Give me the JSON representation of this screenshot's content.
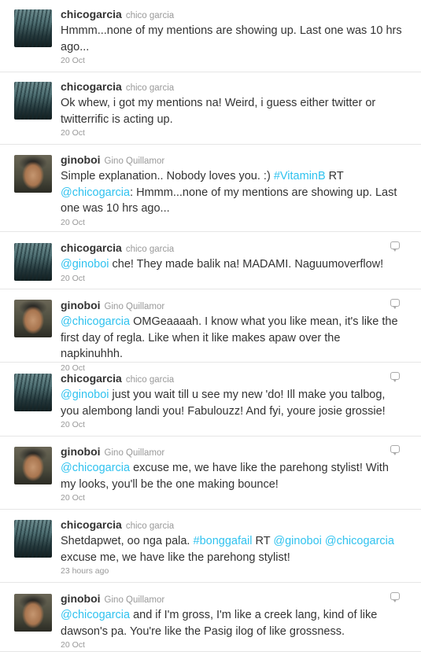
{
  "tweets": [
    {
      "username": "chicogarcia",
      "fullname": "chico garcia",
      "avatar": "chico",
      "parts": [
        {
          "t": "Hmmm...none of my mentions are showing up. Last one was 10 hrs ago..."
        }
      ],
      "time": "20 Oct",
      "reply_icon": false
    },
    {
      "username": "chicogarcia",
      "fullname": "chico garcia",
      "avatar": "chico",
      "parts": [
        {
          "t": "Ok whew, i got my mentions na! Weird, i guess either twitter or twitterrific is acting up."
        }
      ],
      "time": "20 Oct",
      "reply_icon": false
    },
    {
      "username": "ginoboi",
      "fullname": "Gino Quillamor",
      "avatar": "gino",
      "parts": [
        {
          "t": "Simple explanation.. Nobody loves you. :) "
        },
        {
          "l": "#VitaminB"
        },
        {
          "t": " RT "
        },
        {
          "l": "@chicogarcia"
        },
        {
          "t": ": Hmmm...none of my mentions are showing up. Last one was 10 hrs ago..."
        }
      ],
      "time": "20 Oct",
      "reply_icon": false
    },
    {
      "username": "chicogarcia",
      "fullname": "chico garcia",
      "avatar": "chico",
      "parts": [
        {
          "l": "@ginoboi"
        },
        {
          "t": " che! They made balik na! MADAMI. Naguumoverflow!"
        }
      ],
      "time": "20 Oct",
      "reply_icon": true
    },
    {
      "username": "ginoboi",
      "fullname": "Gino Quillamor",
      "avatar": "gino",
      "parts": [
        {
          "l": "@chicogarcia"
        },
        {
          "t": " OMGeaaaah. I know what you like mean, it's like the first day of regla. Like when it like makes apaw over the napkinuhhh."
        }
      ],
      "time": "20 Oct",
      "reply_icon": true
    },
    {
      "username": "chicogarcia",
      "fullname": "chico garcia",
      "avatar": "chico",
      "parts": [
        {
          "l": "@ginoboi"
        },
        {
          "t": " just you wait till u see my new 'do! Ill make you talbog, you alembong landi you! Fabulouzz! And fyi, youre josie grossie!"
        }
      ],
      "time": "20 Oct",
      "reply_icon": true
    },
    {
      "username": "ginoboi",
      "fullname": "Gino Quillamor",
      "avatar": "gino",
      "parts": [
        {
          "l": "@chicogarcia"
        },
        {
          "t": " excuse me, we have like the parehong stylist! With my looks, you'll be the one making bounce!"
        }
      ],
      "time": "20 Oct",
      "reply_icon": true
    },
    {
      "username": "chicogarcia",
      "fullname": "chico garcia",
      "avatar": "chico",
      "parts": [
        {
          "t": "Shetdapwet, oo nga pala. "
        },
        {
          "l": "#bonggafail"
        },
        {
          "t": " RT "
        },
        {
          "l": "@ginoboi"
        },
        {
          "t": " "
        },
        {
          "l": "@chicogarcia"
        },
        {
          "t": " excuse me, we have like the parehong stylist!"
        }
      ],
      "time": "23 hours ago",
      "reply_icon": false
    },
    {
      "username": "ginoboi",
      "fullname": "Gino Quillamor",
      "avatar": "gino",
      "parts": [
        {
          "l": "@chicogarcia"
        },
        {
          "t": " and if I'm gross, I'm like a creek lang, kind of like dawson's pa. You're like the Pasig ilog of like grossness."
        }
      ],
      "time": "20 Oct",
      "reply_icon": true
    }
  ],
  "colors": {
    "link": "#2fc2ef",
    "username": "#333333",
    "meta": "#999999"
  }
}
